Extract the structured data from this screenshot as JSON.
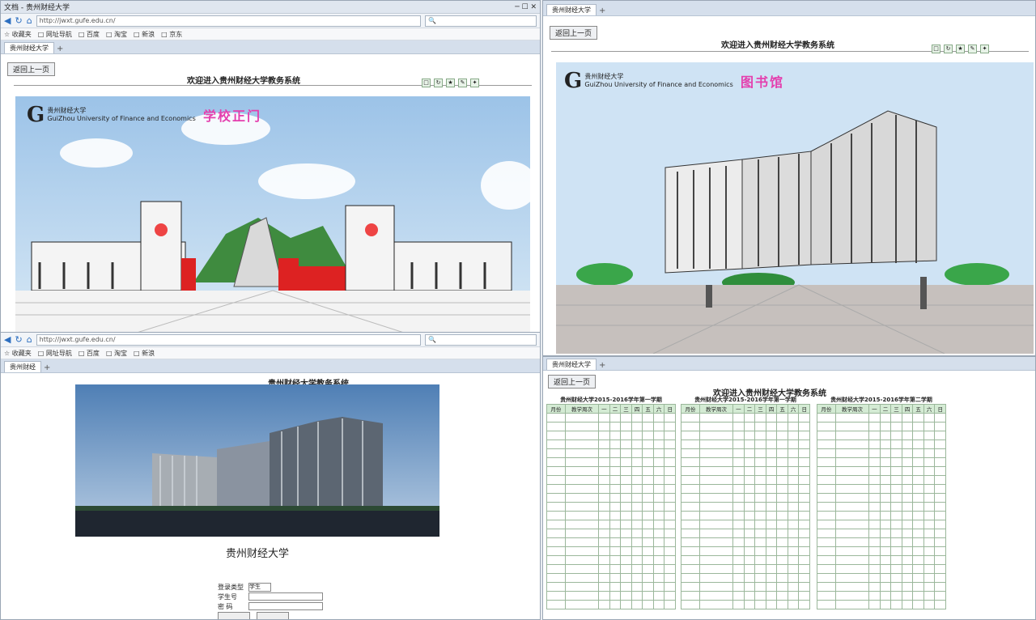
{
  "top_left": {
    "tab": "贵州财经大学",
    "back_button": "返回上一页",
    "sys_title": "欢迎进入贵州财经大学教务系统",
    "logo_letter": "G",
    "logo_cn": "贵州财经大学",
    "logo_en": "GuiZhou University of Finance and Economics",
    "logo_pink": "学校正门"
  },
  "top_right": {
    "tab": "贵州财经大学",
    "back_button": "返回上一页",
    "sys_title": "欢迎进入贵州财经大学教务系统",
    "logo_letter": "G",
    "logo_cn": "贵州财经大学",
    "logo_en": "GuiZhou University of Finance and Economics",
    "logo_pink": "图书馆"
  },
  "bottom_left": {
    "tab": "贵州财经",
    "page_title": "贵州财经大学教务系统",
    "caption": "贵州财经大学",
    "login": {
      "type_label": "登录类型",
      "type_value": "学生",
      "id_label": "学生号",
      "pw_label": "密 码"
    }
  },
  "bottom_right": {
    "tab": "贵州财经大学",
    "back_button": "返回上一页",
    "sys_title": "欢迎进入贵州财经大学教务系统",
    "calendars": [
      {
        "title": "贵州财经大学2015-2016学年第一学期"
      },
      {
        "title": "贵州财经大学2015-2016学年第一学期"
      },
      {
        "title": "贵州财经大学2015-2016学年第二学期"
      }
    ],
    "weekdays": [
      "一",
      "二",
      "三",
      "四",
      "五",
      "六",
      "日"
    ],
    "col_month": "月份",
    "col_week": "教学周次"
  }
}
